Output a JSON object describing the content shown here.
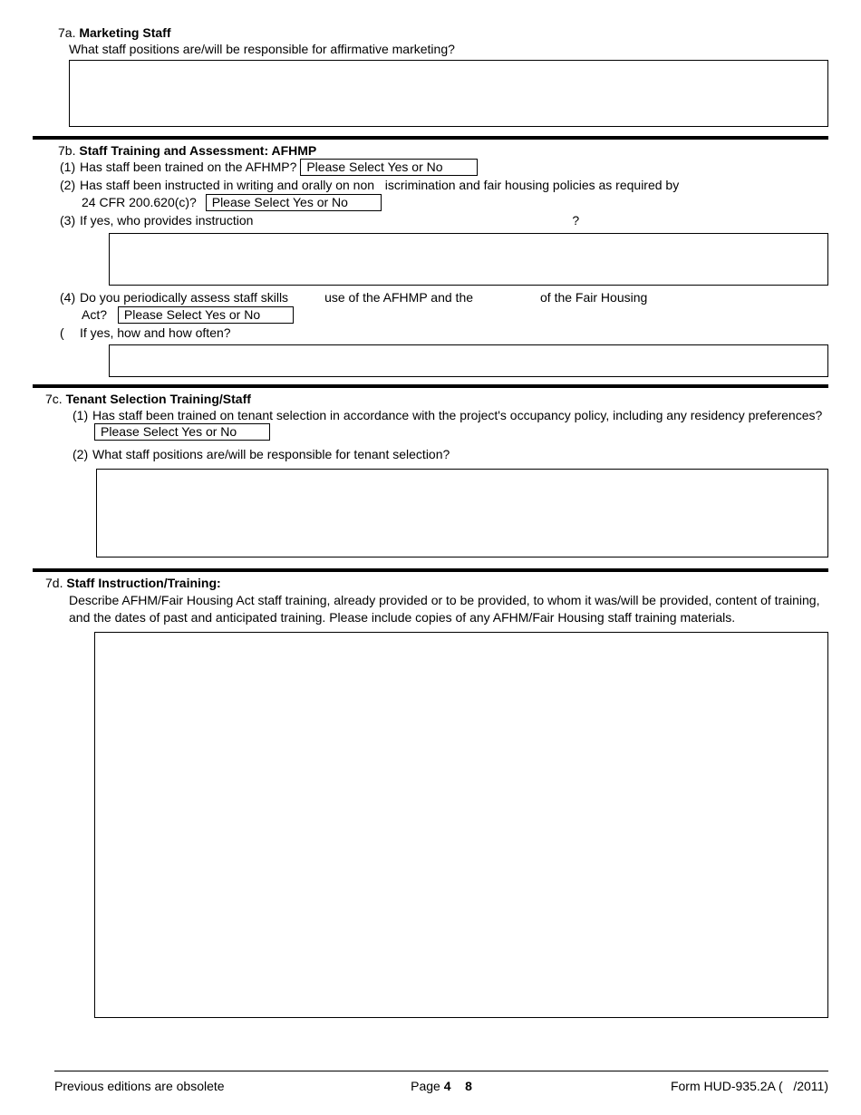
{
  "s7a": {
    "num": "7a.",
    "title": "Marketing Staff",
    "sub": "What staff positions are/will be responsible for affirmative marketing?"
  },
  "s7b": {
    "num": "7b.",
    "title": "Staff Training and Assessment: AFHMP",
    "q1_num": "(1)",
    "q1_text": "Has staff been trained on the AFHMP?",
    "q1_sel": "Please Select Yes or No",
    "q2_num": "(2)",
    "q2_text_a": "Has staff been instructed in writing and orally on non",
    "q2_text_b": "iscrimination and fair housing policies as required by",
    "q2_text_c": "24 CFR 200.620(c)?",
    "q2_sel": "Please Select Yes or No",
    "q3_num": "(3)",
    "q3_text": "If yes, who provides instruction",
    "q3_end": "?",
    "q4_num": "(4)",
    "q4_text_a": "Do you periodically assess staff skills",
    "q4_text_b": "use of the AFHMP and the",
    "q4_text_c": "of the Fair Housing",
    "q4_text_d": "Act?",
    "q4_sel": "Please Select Yes or No",
    "q5_num": "(",
    "q5_text": "If yes, how and how often?"
  },
  "s7c": {
    "num": "7c.",
    "title": "Tenant Selection Training/Staff",
    "q1_num": "(1)",
    "q1_text": "Has staff been trained on tenant selection in accordance with the project's occupancy policy, including any residency preferences?",
    "q1_sel": "Please Select Yes or No",
    "q2_num": "(2)",
    "q2_text": "What staff positions are/will be responsible for tenant selection?"
  },
  "s7d": {
    "num": "7d.",
    "title": "Staff Instruction/Training:",
    "desc": "Describe AFHM/Fair Housing Act staff training, already provided or to be provided, to whom it was/will be provided, content of training, and the dates of past and anticipated training. Please include copies of any AFHM/Fair Housing staff training materials."
  },
  "footer": {
    "left": "Previous editions are obsolete",
    "center_pre": "Page ",
    "center_a": "4",
    "center_sep": "    ",
    "center_b": "8",
    "right_a": "Form HUD-935.2A (",
    "right_b": "/2011)"
  }
}
